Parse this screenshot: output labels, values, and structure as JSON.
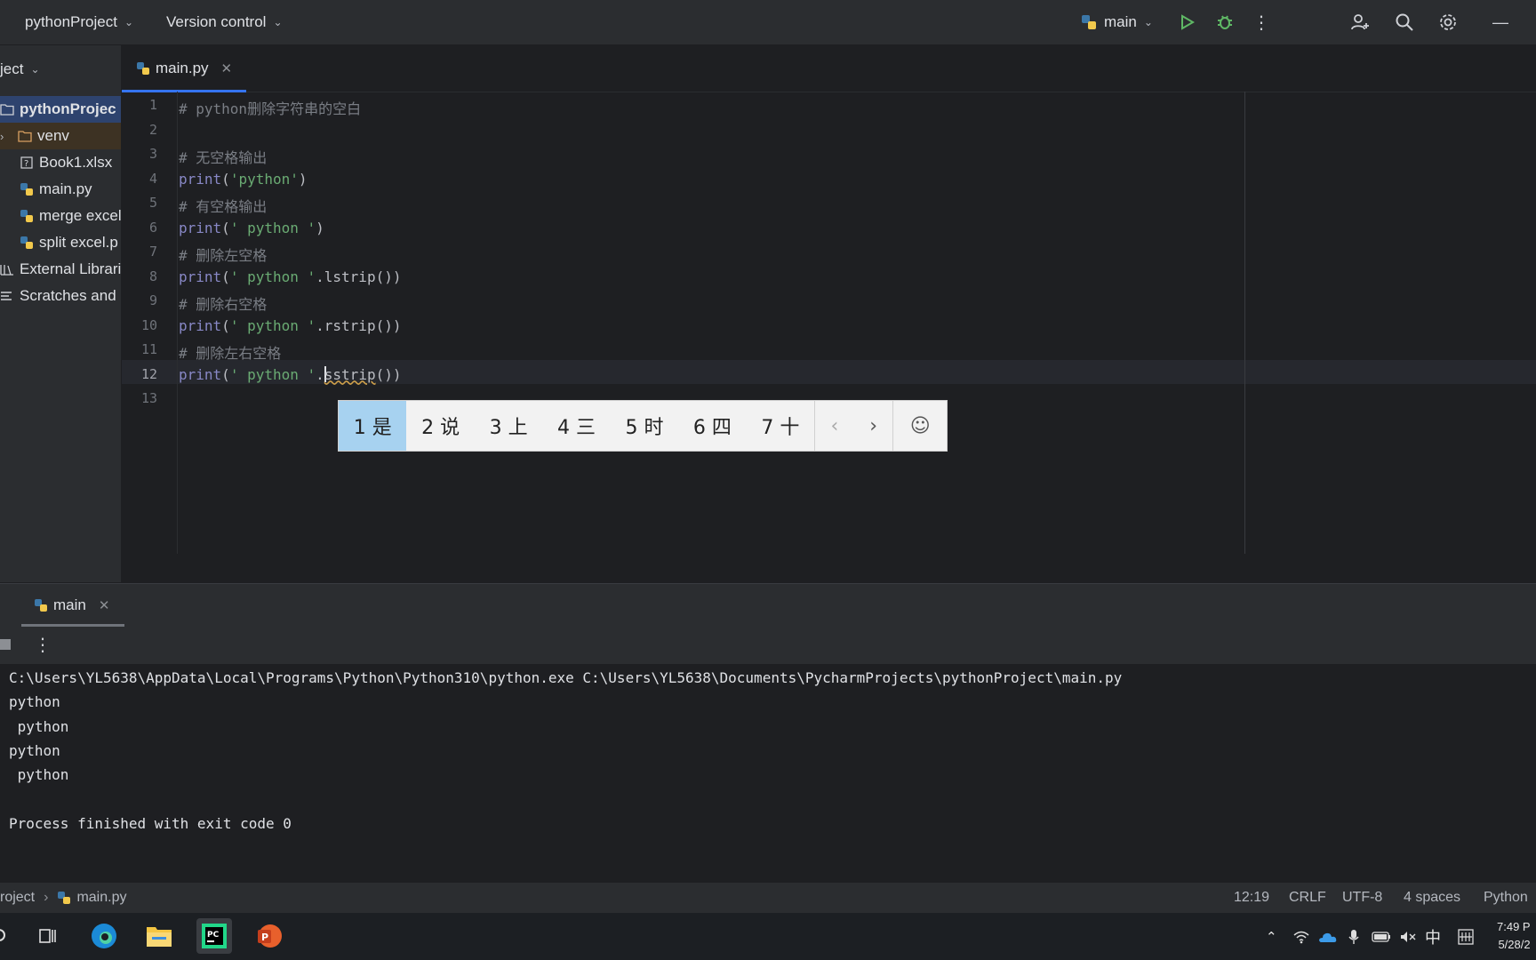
{
  "topbar": {
    "project_name": "pythonProject",
    "vcs_label": "Version control",
    "run_config": "main",
    "icons": [
      "python-icon",
      "run-icon",
      "debug-icon",
      "more-icon",
      "add-user-icon",
      "search-icon",
      "settings-icon",
      "minimize-icon"
    ]
  },
  "project_panel": {
    "header": "ject",
    "items": [
      {
        "label": "pythonProjec",
        "icon": "folder-icon"
      },
      {
        "label": "venv",
        "icon": "folder-icon"
      },
      {
        "label": "Book1.xlsx",
        "icon": "unknown-file-icon"
      },
      {
        "label": "main.py",
        "icon": "python-file-icon"
      },
      {
        "label": "merge excel",
        "icon": "python-file-icon"
      },
      {
        "label": "split excel.p",
        "icon": "python-file-icon"
      },
      {
        "label": "External Librari",
        "icon": "library-icon"
      },
      {
        "label": "Scratches and",
        "icon": "scratches-icon"
      }
    ]
  },
  "editor": {
    "tab_label": "main.py",
    "line_numbers": [
      "1",
      "2",
      "3",
      "4",
      "5",
      "6",
      "7",
      "8",
      "9",
      "10",
      "11",
      "12",
      "13"
    ],
    "current_line": "12",
    "lines": [
      {
        "comment": "# python删除字符串的空白"
      },
      {},
      {
        "comment": "# 无空格输出"
      },
      {
        "fn": "print",
        "open": "(",
        "str": "'python'",
        "close": ")"
      },
      {
        "comment": "# 有空格输出"
      },
      {
        "fn": "print",
        "open": "(",
        "str": "' python '",
        "close": ")"
      },
      {
        "comment": "# 删除左空格"
      },
      {
        "fn": "print",
        "open": "(",
        "str": "' python '",
        "close": ".lstrip())"
      },
      {
        "comment": "# 删除右空格"
      },
      {
        "fn": "print",
        "open": "(",
        "str": "' python '",
        "close": ".rstrip())"
      },
      {
        "comment": "# 删除左右空格"
      },
      {
        "fn": "print",
        "open": "(",
        "str": "' python '",
        "dot": ".",
        "typed": "sstrip",
        "close": "())"
      },
      {}
    ]
  },
  "ime": {
    "candidates": [
      "1 是",
      "2 说",
      "3 上",
      "4 三",
      "5 时",
      "6 四",
      "7 十"
    ],
    "prev": "‹",
    "next": "›",
    "emoji": "☺"
  },
  "run_panel": {
    "tab_label": "main",
    "output": [
      "C:\\Users\\YL5638\\AppData\\Local\\Programs\\Python\\Python310\\python.exe C:\\Users\\YL5638\\Documents\\PycharmProjects\\pythonProject\\main.py",
      "python",
      " python",
      "python",
      " python",
      "",
      "Process finished with exit code 0"
    ]
  },
  "statusbar": {
    "breadcrumb_project": "roject",
    "breadcrumb_file": "main.py",
    "position": "12:19",
    "line_sep": "CRLF",
    "encoding": "UTF-8",
    "indent": "4 spaces",
    "interpreter": "Python"
  },
  "taskbar": {
    "apps": [
      "search-icon",
      "task-view-icon",
      "edge-icon",
      "file-explorer-icon",
      "pycharm-icon",
      "powerpoint-icon"
    ],
    "ime_indicator": "中",
    "time": "7:49 P",
    "date": "5/28/2"
  }
}
